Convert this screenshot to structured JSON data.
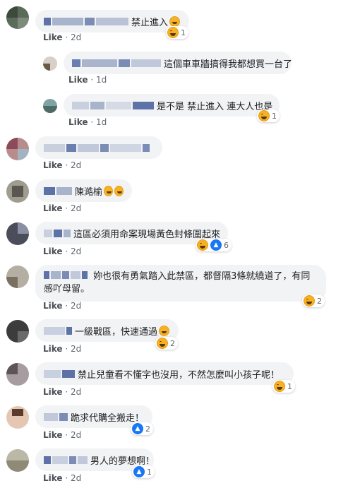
{
  "comments": [
    {
      "text": "禁止進入",
      "emoji_after": 1,
      "meta": {
        "like": "Like",
        "sep": "·",
        "time": "2d"
      },
      "reaction": {
        "type": "haha",
        "count": "1"
      }
    },
    {
      "text": "這個車車牆搞得我都想買一台了",
      "emoji_after": 0,
      "meta": {
        "like": "Like",
        "sep": "·",
        "time": "1d"
      },
      "reaction": null
    },
    {
      "text": "是不是 禁止進入 連大人也是",
      "emoji_after": 0,
      "meta": {
        "like": "Like",
        "sep": "·",
        "time": "1d"
      },
      "reaction": {
        "type": "haha",
        "count": "1"
      }
    },
    {
      "text": "",
      "emoji_after": 0,
      "meta": {
        "like": "Like",
        "sep": "·",
        "time": "2d"
      },
      "reaction": null
    },
    {
      "text": "陳澔榆",
      "emoji_after": 2,
      "meta": {
        "like": "Like",
        "sep": "·",
        "time": "2d"
      },
      "reaction": null
    },
    {
      "text": "這區必須用命案現場黃色封條圍起來",
      "emoji_after": 0,
      "meta": {
        "like": "Like",
        "sep": "·",
        "time": "2d"
      },
      "reaction": {
        "type": "haha+like",
        "count": "6"
      }
    },
    {
      "text": "妳也很有勇氣踏入此禁區，都督隔3條就繞道了，有同感吖母留。",
      "emoji_after": 0,
      "meta": {
        "like": "Like",
        "sep": "·",
        "time": "2d"
      },
      "reaction": {
        "type": "haha",
        "count": "2"
      }
    },
    {
      "text": "一級戰區，快速通過",
      "emoji_after": 1,
      "meta": {
        "like": "Like",
        "sep": "·",
        "time": "2d"
      },
      "reaction": {
        "type": "haha",
        "count": "2"
      }
    },
    {
      "text": "禁止兒童看不懂字也沒用，不然怎麼叫小孩子呢！",
      "emoji_after": 0,
      "meta": {
        "like": "Like",
        "sep": "·",
        "time": "2d"
      },
      "reaction": {
        "type": "haha",
        "count": "1"
      }
    },
    {
      "text": "跪求代購全搬走！",
      "emoji_after": 0,
      "meta": {
        "like": "Like",
        "sep": "·",
        "time": "2d"
      },
      "reaction": {
        "type": "like",
        "count": "2"
      }
    },
    {
      "text": "男人的夢想啊！",
      "emoji_after": 0,
      "meta": {
        "like": "Like",
        "sep": "·",
        "time": "2d"
      },
      "reaction": {
        "type": "like",
        "count": "1"
      }
    }
  ],
  "colors": {
    "bubble": "#f2f3f5",
    "meta": "#606770",
    "blur_name": "#3b5998",
    "haha": "#f7b125",
    "like": "#1877f2"
  }
}
